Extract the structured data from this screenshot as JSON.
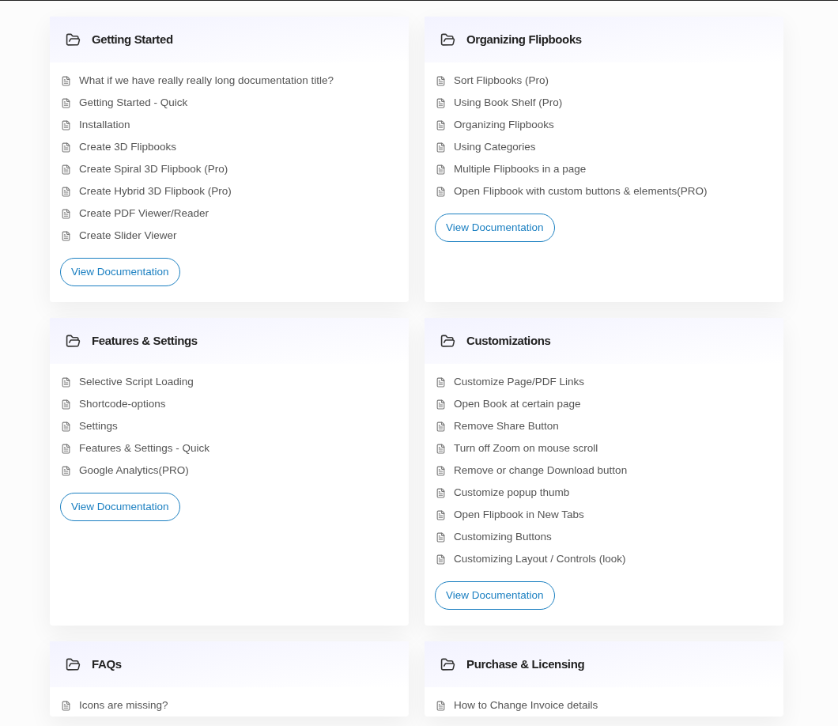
{
  "sections": [
    {
      "title": "Getting Started",
      "articles": [
        "What if we have really really long documentation title?",
        "Getting Started - Quick",
        "Installation",
        "Create 3D Flipbooks",
        "Create Spiral 3D Flipbook (Pro)",
        "Create Hybrid 3D Flipbook (Pro)",
        "Create PDF Viewer/Reader",
        "Create Slider Viewer"
      ],
      "button": "View Documentation"
    },
    {
      "title": "Organizing Flipbooks",
      "articles": [
        "Sort Flipbooks (Pro)",
        "Using Book Shelf (Pro)",
        "Organizing Flipbooks",
        "Using Categories",
        "Multiple Flipbooks in a page",
        "Open Flipbook with custom buttons & elements(PRO)"
      ],
      "button": "View Documentation"
    },
    {
      "title": "Features & Settings",
      "articles": [
        "Selective Script Loading",
        "Shortcode-options",
        "Settings",
        "Features & Settings - Quick",
        "Google Analytics(PRO)"
      ],
      "button": "View Documentation"
    },
    {
      "title": "Customizations",
      "articles": [
        "Customize Page/PDF Links",
        "Open Book at certain page",
        "Remove Share Button",
        "Turn off Zoom on mouse scroll",
        "Remove or change Download button",
        "Customize popup thumb",
        "Open Flipbook in New Tabs",
        "Customizing Buttons",
        "Customizing Layout / Controls (look)"
      ],
      "button": "View Documentation"
    },
    {
      "title": "FAQs",
      "articles": [
        "Icons are missing?"
      ]
    },
    {
      "title": "Purchase & Licensing",
      "articles": [
        "How to Change Invoice details"
      ]
    }
  ]
}
